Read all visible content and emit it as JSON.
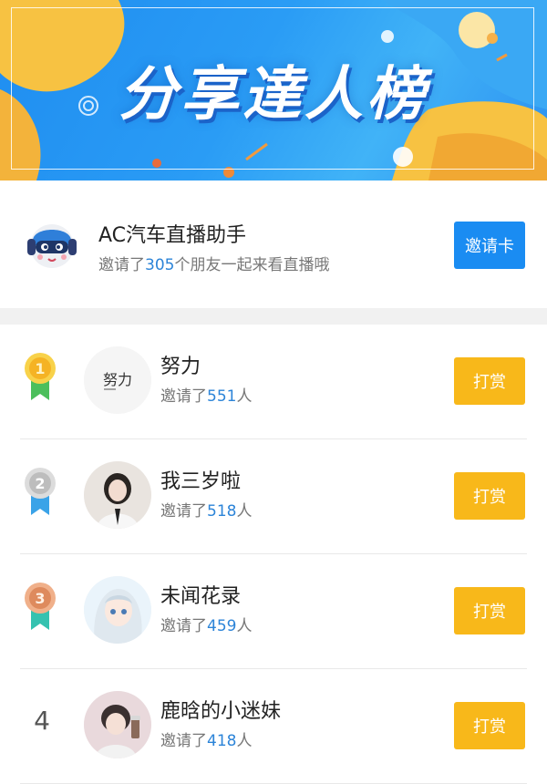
{
  "banner": {
    "title": "分享達人榜"
  },
  "host": {
    "name": "AC汽车直播助手",
    "invite_prefix": "邀请了",
    "invite_count": "305",
    "invite_suffix": "个朋友一起来看直播哦",
    "button_label": "邀请卡"
  },
  "ranking": {
    "invite_prefix": "邀请了",
    "invite_suffix": "人",
    "button_label": "打赏",
    "entries": [
      {
        "rank": "1",
        "name": "努力",
        "count": "551",
        "avatar_text": "努力"
      },
      {
        "rank": "2",
        "name": "我三岁啦",
        "count": "518"
      },
      {
        "rank": "3",
        "name": "未闻花录",
        "count": "459"
      },
      {
        "rank": "4",
        "name": "鹿晗的小迷妹",
        "count": "418"
      }
    ]
  },
  "colors": {
    "accent_blue": "#1a8cf2",
    "reward_yellow": "#f8b81a",
    "count_blue": "#2c84d8",
    "gold": "#f5c12a",
    "silver": "#c9c9c9",
    "bronze": "#e39a72"
  }
}
